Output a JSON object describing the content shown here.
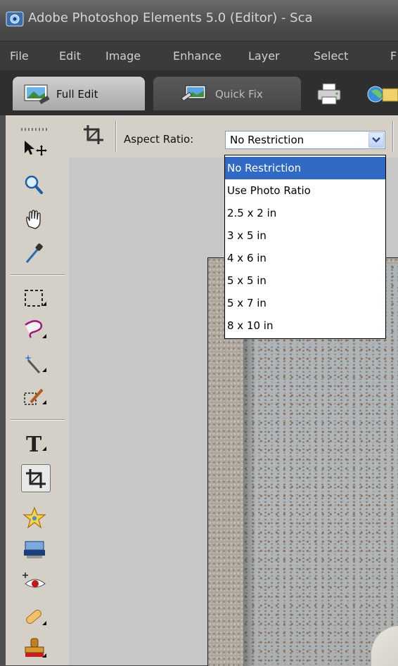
{
  "window": {
    "title": "Adobe Photoshop Elements 5.0 (Editor) - Sca",
    "icon": "photoshop-elements-app-icon"
  },
  "menubar": {
    "items": [
      "File",
      "Edit",
      "Image",
      "Enhance",
      "Layer",
      "Select",
      "F"
    ]
  },
  "tabs": [
    {
      "label": "Full Edit",
      "icon": "full-edit-icon",
      "active": true
    },
    {
      "label": "Quick Fix",
      "icon": "quick-fix-icon",
      "active": false
    }
  ],
  "toolbar_buttons": [
    "print-icon",
    "organizer-icon"
  ],
  "toolbox": {
    "tools": [
      "move-tool",
      "zoom-tool",
      "hand-tool",
      "eyedropper-tool",
      "marquee-tool",
      "lasso-tool",
      "magic-wand-tool",
      "selection-brush-tool",
      "type-tool",
      "crop-tool",
      "custom-shape-tool",
      "cookie-cutter-tool",
      "red-eye-tool",
      "healing-brush-tool",
      "clone-stamp-tool"
    ],
    "active_tool": "crop-tool"
  },
  "options": {
    "aspect_label": "Aspect Ratio:",
    "aspect_value": "No Restriction"
  },
  "dropdown": {
    "options": [
      "No Restriction",
      "Use Photo Ratio",
      "2.5 x 2 in",
      "3 x 5 in",
      "4 x 6 in",
      "5 x 5 in",
      "5 x 7 in",
      "8 x 10 in"
    ],
    "selected_index": 0
  },
  "colors": {
    "selection": "#316ac5",
    "toolbox": "#d4d0c8",
    "titlebar": "#5a5a5a"
  }
}
